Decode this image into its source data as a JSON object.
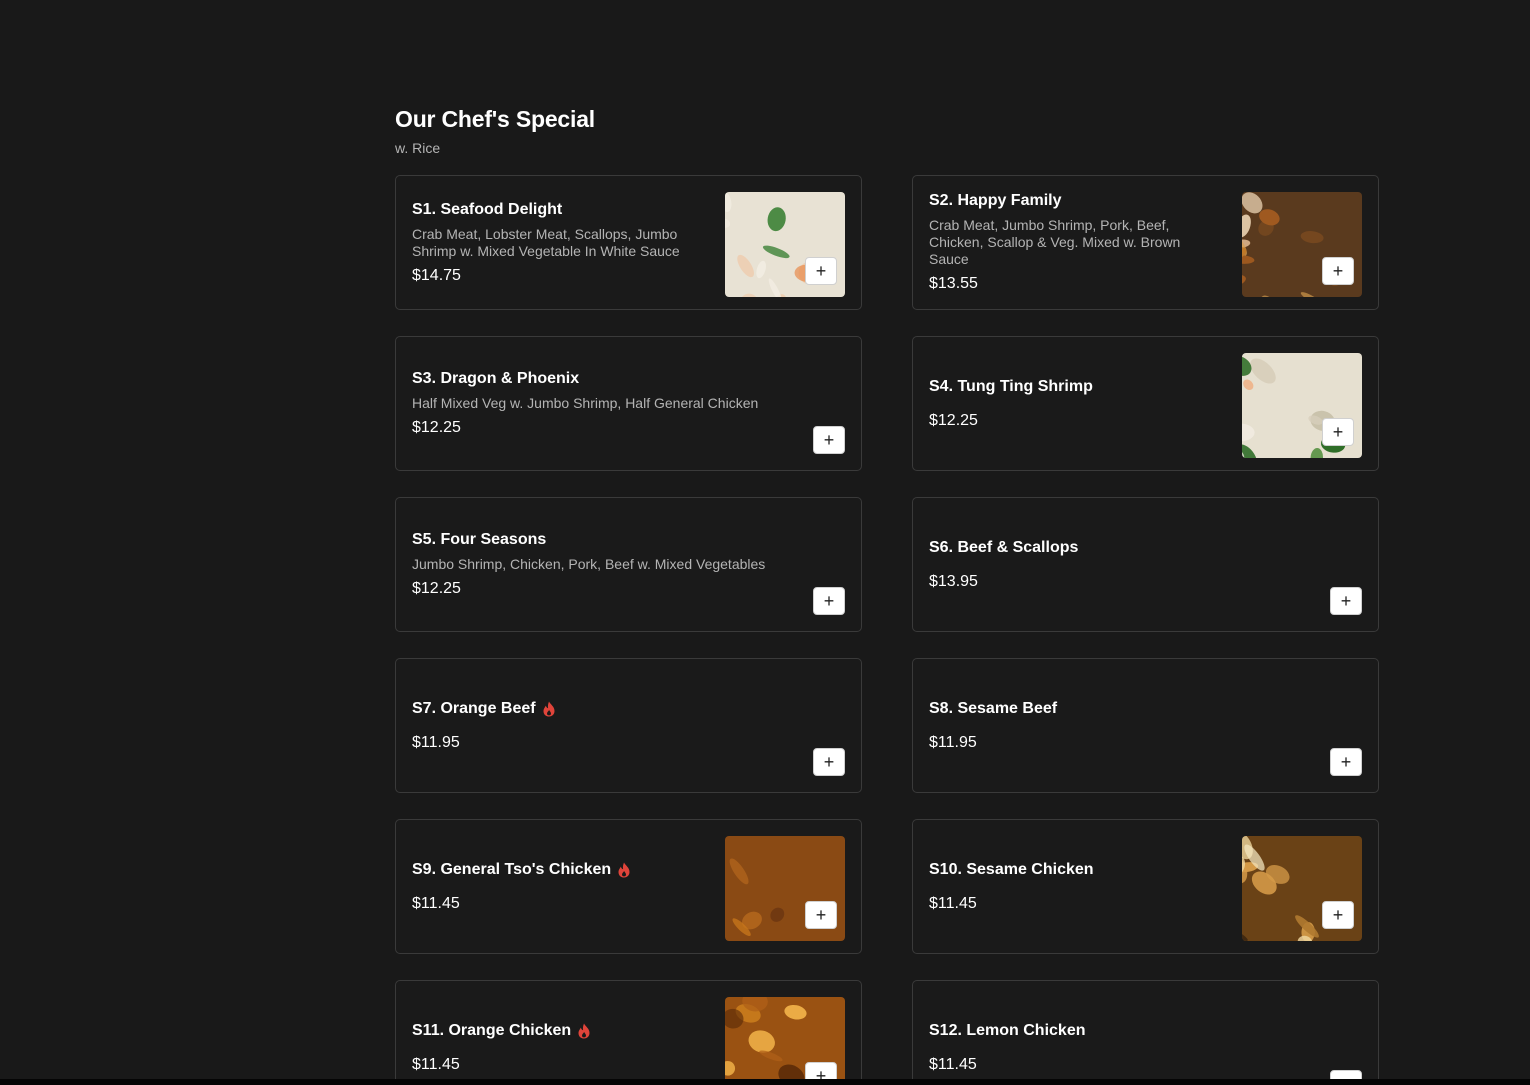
{
  "section": {
    "title": "Our Chef's Special",
    "subtitle": "w. Rice"
  },
  "items": [
    {
      "name": "S1. Seafood Delight",
      "description": "Crab Meat, Lobster Meat, Scallops, Jumbo Shrimp w. Mixed Vegetable In White Sauce",
      "price": "$14.75",
      "spicy": false,
      "image": "seafood-delight-photo",
      "add_label": "+"
    },
    {
      "name": "S2. Happy Family",
      "description": "Crab Meat, Jumbo Shrimp, Pork, Beef, Chicken, Scallop & Veg. Mixed w. Brown Sauce",
      "price": "$13.55",
      "spicy": false,
      "image": "happy-family-photo",
      "add_label": "+"
    },
    {
      "name": "S3. Dragon & Phoenix",
      "description": "Half Mixed Veg w. Jumbo Shrimp, Half General Chicken",
      "price": "$12.25",
      "spicy": false,
      "image": null,
      "add_label": "+"
    },
    {
      "name": "S4. Tung Ting Shrimp",
      "description": "",
      "price": "$12.25",
      "spicy": false,
      "image": "tung-ting-shrimp-photo",
      "add_label": "+"
    },
    {
      "name": "S5. Four Seasons",
      "description": "Jumbo Shrimp, Chicken, Pork, Beef w. Mixed Vegetables",
      "price": "$12.25",
      "spicy": false,
      "image": null,
      "add_label": "+"
    },
    {
      "name": "S6. Beef & Scallops",
      "description": "",
      "price": "$13.95",
      "spicy": false,
      "image": null,
      "add_label": "+"
    },
    {
      "name": "S7. Orange Beef",
      "description": "",
      "price": "$11.95",
      "spicy": true,
      "image": null,
      "add_label": "+"
    },
    {
      "name": "S8. Sesame Beef",
      "description": "",
      "price": "$11.95",
      "spicy": false,
      "image": null,
      "add_label": "+"
    },
    {
      "name": "S9. General Tso's Chicken",
      "description": "",
      "price": "$11.45",
      "spicy": true,
      "image": "general-tso-chicken-photo",
      "add_label": "+"
    },
    {
      "name": "S10. Sesame Chicken",
      "description": "",
      "price": "$11.45",
      "spicy": false,
      "image": "sesame-chicken-photo",
      "add_label": "+"
    },
    {
      "name": "S11. Orange Chicken",
      "description": "",
      "price": "$11.45",
      "spicy": true,
      "image": "orange-chicken-photo",
      "add_label": "+"
    },
    {
      "name": "S12. Lemon Chicken",
      "description": "",
      "price": "$11.45",
      "spicy": false,
      "image": null,
      "add_label": "+"
    }
  ],
  "icons": {
    "spicy": "spicy-flame-icon",
    "add": "plus-icon"
  },
  "colors": {
    "background": "#191919",
    "card_border": "#3a3a3a",
    "text_primary": "#ffffff",
    "text_secondary": "#b4b4b4",
    "spicy": "#e0443a"
  }
}
